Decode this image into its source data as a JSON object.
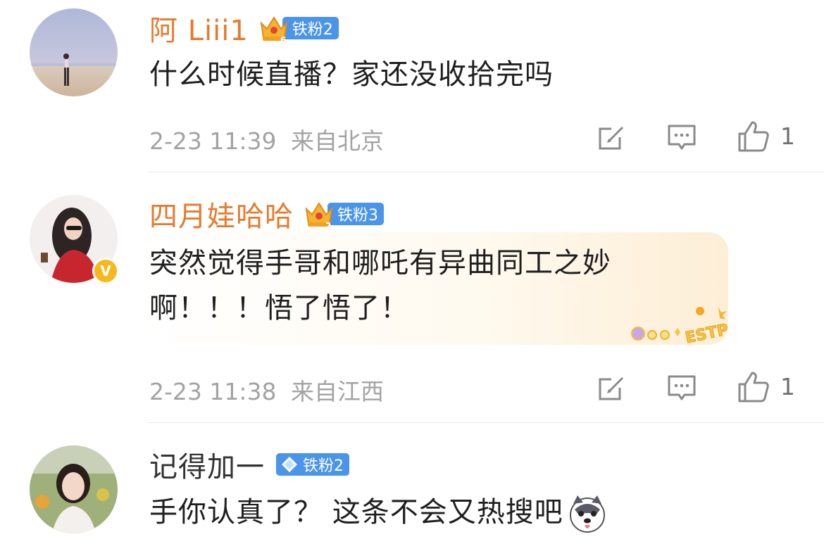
{
  "comments": [
    {
      "username": "阿 Liii1",
      "fan_badge": "铁粉2",
      "crown_level": "6",
      "text": "什么时候直播？家还没收拾完吗",
      "time": "2-23 11:39",
      "location": "来自北京",
      "likes": "1"
    },
    {
      "username": "四月娃哈哈",
      "fan_badge": "铁粉3",
      "crown_level": "2",
      "text_line1": "突然觉得手哥和哪吒有异曲同工之妙",
      "text_line2": "啊！！！悟了悟了！",
      "decoration_text": "ESTP",
      "time": "2-23 11:38",
      "location": "来自江西",
      "likes": "1"
    },
    {
      "username": "记得加一",
      "fan_badge": "铁粉2",
      "text": "手你认真了？ 这条不会又热搜吧"
    }
  ],
  "icons": {
    "edit": "edit-icon",
    "reply": "comment-icon",
    "like": "thumbs-up-icon",
    "verified": "verified-v-icon"
  },
  "colors": {
    "vip_name": "#e57b2f",
    "fan_badge_bg": "#4a95ea",
    "meta_text": "#a3a3a3",
    "verified_badge": "#f6b81a"
  }
}
